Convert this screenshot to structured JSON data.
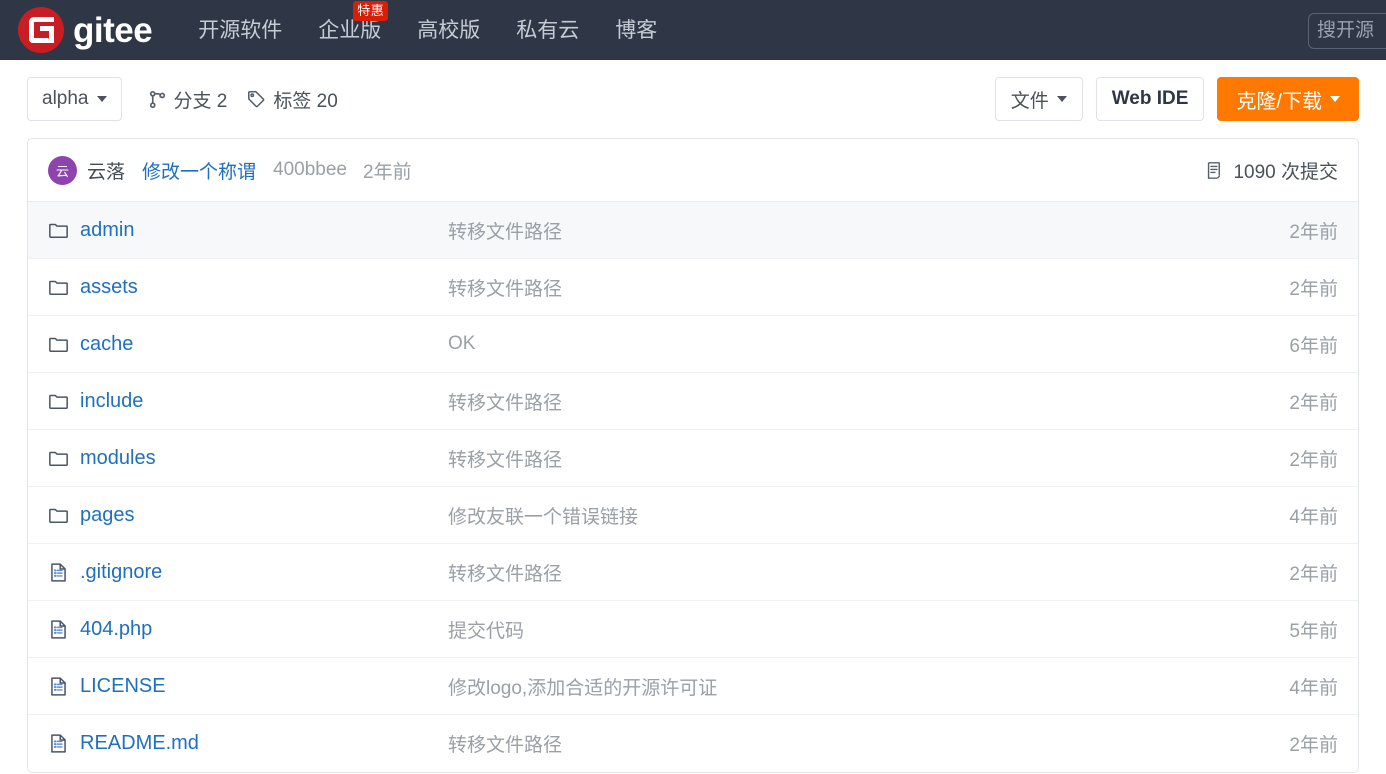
{
  "header": {
    "logo_text": "gitee",
    "logo_icon": "gitee-g-logo-icon",
    "nav": [
      {
        "label": "开源软件",
        "badge": null
      },
      {
        "label": "企业版",
        "badge": "特惠"
      },
      {
        "label": "高校版",
        "badge": null
      },
      {
        "label": "私有云",
        "badge": null
      },
      {
        "label": "博客",
        "badge": null
      }
    ],
    "search": {
      "placeholder": "搜开源",
      "value": ""
    },
    "colors": {
      "bg": "#2F3746",
      "logo_red": "#C71D23",
      "badge_red": "#D81E06"
    }
  },
  "toolbar": {
    "branch": "alpha",
    "branches_label": "分支 2",
    "tags_label": "标签 20",
    "files_button": "文件",
    "web_ide_button": "Web IDE",
    "clone_button": "克隆/下载",
    "accent_orange": "#FF7800"
  },
  "commit_bar": {
    "avatar_initial": "云",
    "avatar_color": "#8E44AD",
    "author": "云落",
    "message": "修改一个称谓",
    "sha": "400bbee",
    "time": "2年前",
    "commit_count_label": "1090 次提交"
  },
  "files": [
    {
      "type": "folder",
      "name": "admin",
      "message": "转移文件路径",
      "time": "2年前",
      "hovered": true
    },
    {
      "type": "folder",
      "name": "assets",
      "message": "转移文件路径",
      "time": "2年前",
      "hovered": false
    },
    {
      "type": "folder",
      "name": "cache",
      "message": "OK",
      "time": "6年前",
      "hovered": false
    },
    {
      "type": "folder",
      "name": "include",
      "message": "转移文件路径",
      "time": "2年前",
      "hovered": false
    },
    {
      "type": "folder",
      "name": "modules",
      "message": "转移文件路径",
      "time": "2年前",
      "hovered": false
    },
    {
      "type": "folder",
      "name": "pages",
      "message": "修改友联一个错误链接",
      "time": "4年前",
      "hovered": false
    },
    {
      "type": "file",
      "name": ".gitignore",
      "message": "转移文件路径",
      "time": "2年前",
      "hovered": false
    },
    {
      "type": "file",
      "name": "404.php",
      "message": "提交代码",
      "time": "5年前",
      "hovered": false
    },
    {
      "type": "file",
      "name": "LICENSE",
      "message": "修改logo,添加合适的开源许可证",
      "time": "4年前",
      "hovered": false
    },
    {
      "type": "file",
      "name": "README.md",
      "message": "转移文件路径",
      "time": "2年前",
      "hovered": false
    }
  ]
}
